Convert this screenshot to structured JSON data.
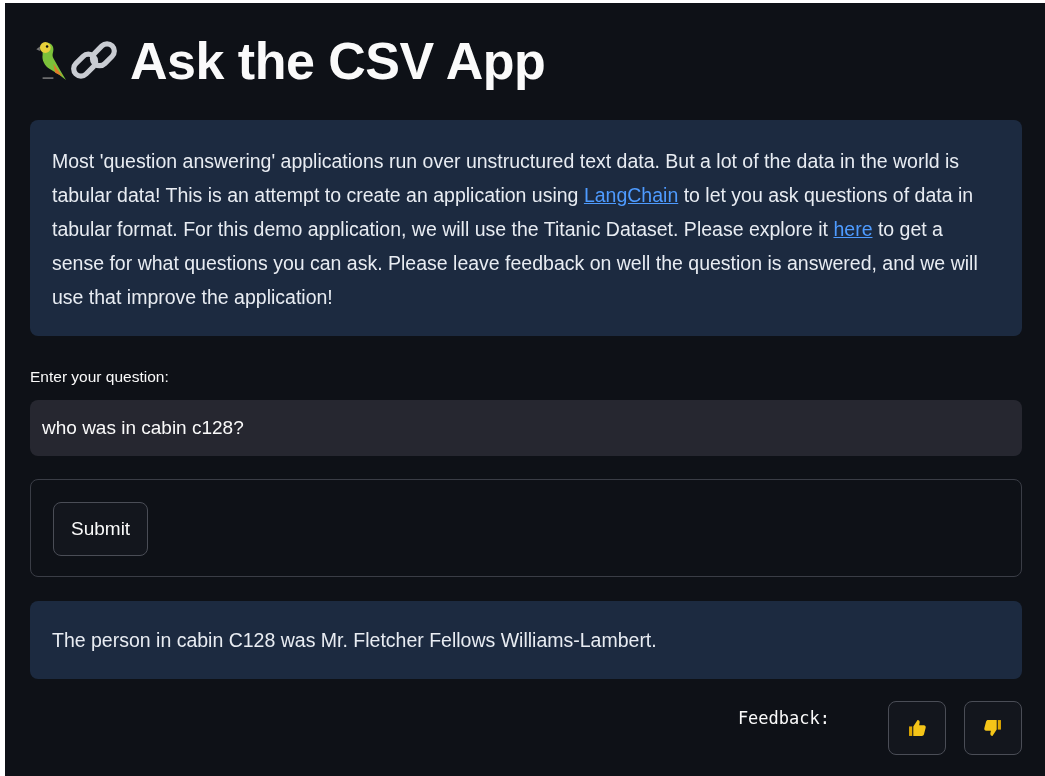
{
  "title": "Ask the CSV App",
  "intro": [
    {
      "kind": "text",
      "text": "Most 'question answering' applications run over unstructured text data. But a lot of the data in the world is tabular data! This is an attempt to create an application using "
    },
    {
      "kind": "link",
      "text": "LangChain"
    },
    {
      "kind": "text",
      "text": " to let you ask questions of data in tabular format. For this demo application, we will use the Titanic Dataset. Please explore it "
    },
    {
      "kind": "link",
      "text": "here"
    },
    {
      "kind": "text",
      "text": " to get a sense for what questions you can ask. Please leave feedback on well the question is answered, and we will use that improve the application!"
    }
  ],
  "question": {
    "label": "Enter your question:",
    "value": "who was in cabin c128?"
  },
  "submit": "Submit",
  "answer": "The person in cabin C128 was Mr. Fletcher Fellows Williams-Lambert.",
  "feedback": {
    "label": "Feedback:",
    "buttons": [
      {
        "kind": "up"
      },
      {
        "kind": "down"
      }
    ]
  }
}
